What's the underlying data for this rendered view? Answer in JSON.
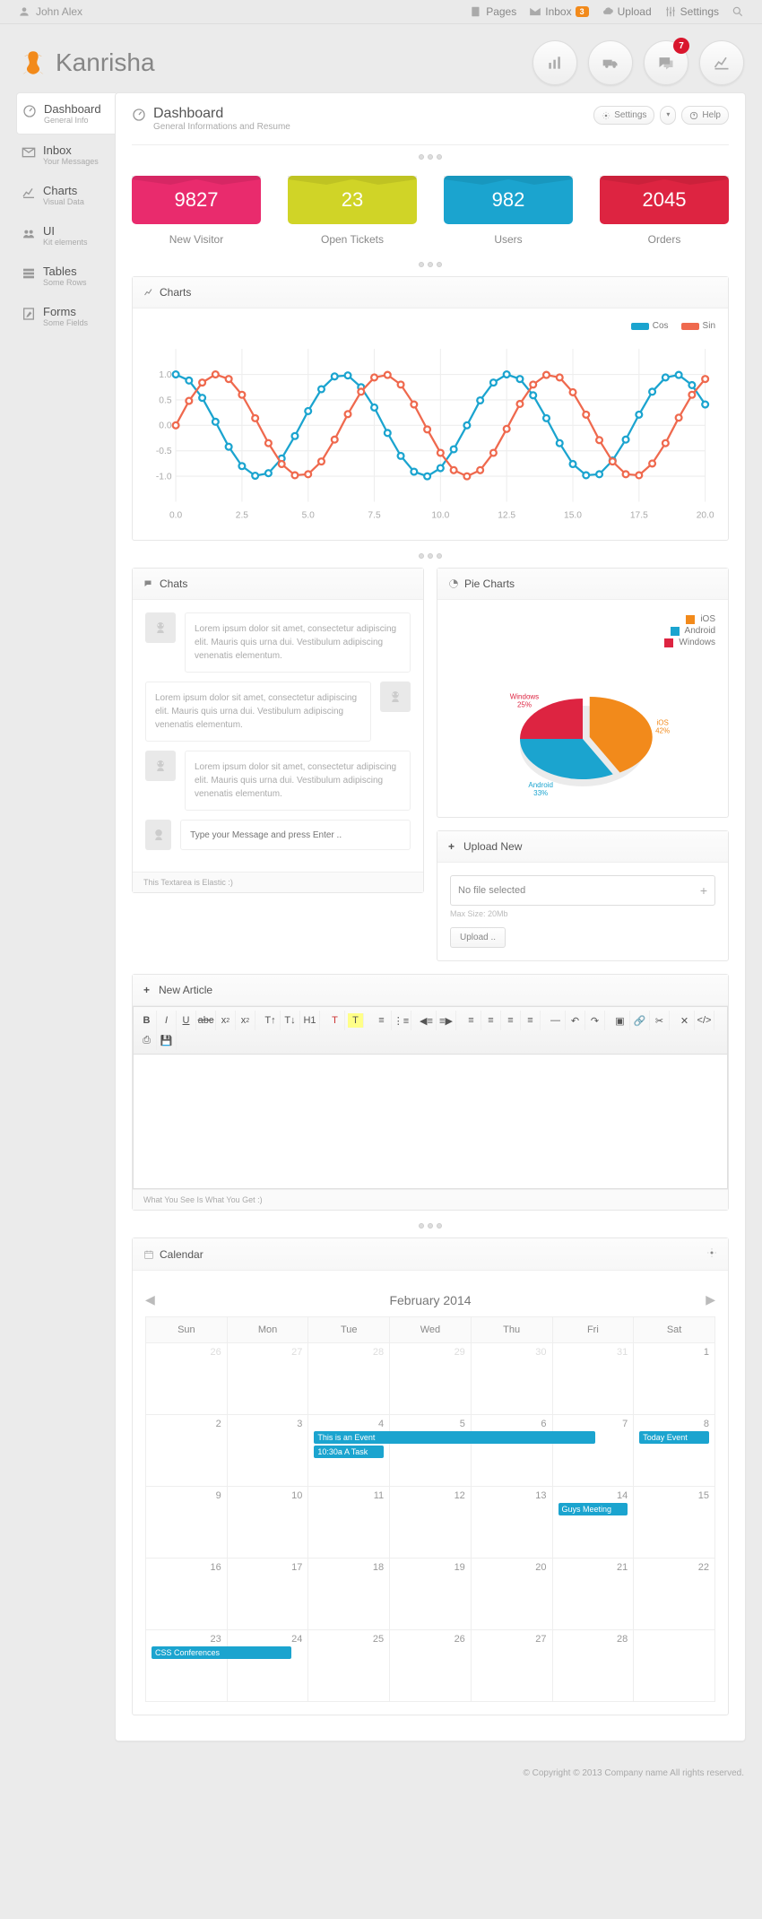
{
  "topbar": {
    "user": "John Alex",
    "items": {
      "pages": "Pages",
      "inbox": "Inbox",
      "inbox_count": "3",
      "upload": "Upload",
      "settings": "Settings"
    }
  },
  "brand": "Kanrisha",
  "header_badge": "7",
  "sidebar": {
    "items": [
      {
        "t": "Dashboard",
        "s": "General Info"
      },
      {
        "t": "Inbox",
        "s": "Your Messages"
      },
      {
        "t": "Charts",
        "s": "Visual Data"
      },
      {
        "t": "UI",
        "s": "Kit elements"
      },
      {
        "t": "Tables",
        "s": "Some Rows"
      },
      {
        "t": "Forms",
        "s": "Some Fields"
      }
    ]
  },
  "page": {
    "title": "Dashboard",
    "subtitle": "General Informations and Resume",
    "settings": "Settings",
    "help": "Help"
  },
  "stats": [
    {
      "value": "9827",
      "label": "New Visitor",
      "color": "c-pink"
    },
    {
      "value": "23",
      "label": "Open Tickets",
      "color": "c-yellow"
    },
    {
      "value": "982",
      "label": "Users",
      "color": "c-blue"
    },
    {
      "value": "2045",
      "label": "Orders",
      "color": "c-red"
    }
  ],
  "charts_panel": {
    "title": "Charts"
  },
  "chart_data": [
    {
      "type": "line",
      "title": "Charts",
      "xlabel": "",
      "ylabel": "",
      "x_range": [
        0,
        20
      ],
      "y_range": [
        -1.5,
        1.5
      ],
      "x_ticks": [
        0,
        2.5,
        5.0,
        7.5,
        10.0,
        12.5,
        15.0,
        17.5,
        20.0
      ],
      "y_ticks": [
        -1.0,
        -0.5,
        0.0,
        0.5,
        1.0
      ],
      "series": [
        {
          "name": "Cos",
          "color": "#1ba4cf",
          "x": [
            0,
            0.5,
            1,
            1.5,
            2,
            2.5,
            3,
            3.5,
            4,
            4.5,
            5,
            5.5,
            6,
            6.5,
            7,
            7.5,
            8,
            8.5,
            9,
            9.5,
            10,
            10.5,
            11,
            11.5,
            12,
            12.5,
            13,
            13.5,
            14,
            14.5,
            15,
            15.5,
            16,
            16.5,
            17,
            17.5,
            18,
            18.5,
            19,
            19.5,
            20
          ],
          "values": [
            1.0,
            0.88,
            0.54,
            0.07,
            -0.42,
            -0.8,
            -0.99,
            -0.94,
            -0.65,
            -0.21,
            0.28,
            0.71,
            0.96,
            0.98,
            0.75,
            0.35,
            -0.15,
            -0.6,
            -0.91,
            -1.0,
            -0.84,
            -0.47,
            0.0,
            0.49,
            0.84,
            1.0,
            0.91,
            0.59,
            0.14,
            -0.35,
            -0.76,
            -0.98,
            -0.96,
            -0.69,
            -0.28,
            0.21,
            0.66,
            0.94,
            0.99,
            0.79,
            0.41
          ]
        },
        {
          "name": "Sin",
          "color": "#ef694e",
          "x": [
            0,
            0.5,
            1,
            1.5,
            2,
            2.5,
            3,
            3.5,
            4,
            4.5,
            5,
            5.5,
            6,
            6.5,
            7,
            7.5,
            8,
            8.5,
            9,
            9.5,
            10,
            10.5,
            11,
            11.5,
            12,
            12.5,
            13,
            13.5,
            14,
            14.5,
            15,
            15.5,
            16,
            16.5,
            17,
            17.5,
            18,
            18.5,
            19,
            19.5,
            20
          ],
          "values": [
            0.0,
            0.48,
            0.84,
            1.0,
            0.91,
            0.6,
            0.14,
            -0.35,
            -0.76,
            -0.98,
            -0.96,
            -0.71,
            -0.28,
            0.22,
            0.66,
            0.94,
            0.99,
            0.8,
            0.41,
            -0.08,
            -0.54,
            -0.88,
            -1.0,
            -0.88,
            -0.54,
            -0.07,
            0.42,
            0.8,
            0.99,
            0.94,
            0.65,
            0.21,
            -0.29,
            -0.71,
            -0.96,
            -0.98,
            -0.75,
            -0.35,
            0.15,
            0.6,
            0.91
          ]
        }
      ]
    },
    {
      "type": "pie",
      "title": "Pie Charts",
      "series": [
        {
          "name": "iOS",
          "value": 42,
          "label": "iOS 42%",
          "color": "#f28a1b"
        },
        {
          "name": "Android",
          "value": 33,
          "label": "Android 33%",
          "color": "#1ba4cf"
        },
        {
          "name": "Windows",
          "value": 25,
          "label": "Windows 25%",
          "color": "#dd2441"
        }
      ]
    }
  ],
  "chats": {
    "title": "Chats",
    "items": [
      "Lorem ipsum dolor sit amet, consectetur adipiscing elit. Mauris quis urna dui. Vestibulum adipiscing venenatis elementum.",
      "Lorem ipsum dolor sit amet, consectetur adipiscing elit. Mauris quis urna dui. Vestibulum adipiscing venenatis elementum.",
      "Lorem ipsum dolor sit amet, consectetur adipiscing elit. Mauris quis urna dui. Vestibulum adipiscing venenatis elementum."
    ],
    "placeholder": "Type your Message and press Enter ..",
    "footer": "This Textarea is Elastic :)"
  },
  "pie_panel": {
    "title": "Pie Charts"
  },
  "upload": {
    "title": "Upload New",
    "placeholder": "No file selected",
    "hint": "Max Size: 20Mb",
    "button": "Upload .."
  },
  "article": {
    "title": "New Article",
    "footer": "What You See Is What You Get :)"
  },
  "calendar": {
    "title": "Calendar",
    "month": "February 2014",
    "days": [
      "Sun",
      "Mon",
      "Tue",
      "Wed",
      "Thu",
      "Fri",
      "Sat"
    ],
    "weeks": [
      [
        {
          "d": "26",
          "o": 1
        },
        {
          "d": "27",
          "o": 1
        },
        {
          "d": "28",
          "o": 1
        },
        {
          "d": "29",
          "o": 1
        },
        {
          "d": "30",
          "o": 1
        },
        {
          "d": "31",
          "o": 1
        },
        {
          "d": "1"
        }
      ],
      [
        {
          "d": "2"
        },
        {
          "d": "3"
        },
        {
          "d": "4",
          "events": [
            {
              "t": "This is an Event",
              "span": 4
            }
          ]
        },
        {
          "d": "5"
        },
        {
          "d": "6"
        },
        {
          "d": "7"
        },
        {
          "d": "8",
          "events": [
            {
              "t": "Today Event"
            }
          ]
        }
      ],
      [
        {
          "d": "9"
        },
        {
          "d": "10"
        },
        {
          "d": "11"
        },
        {
          "d": "12"
        },
        {
          "d": "13"
        },
        {
          "d": "14",
          "events": [
            {
              "t": "Guys Meeting"
            }
          ]
        },
        {
          "d": "15"
        }
      ],
      [
        {
          "d": "16"
        },
        {
          "d": "17"
        },
        {
          "d": "18"
        },
        {
          "d": "19"
        },
        {
          "d": "20"
        },
        {
          "d": "21"
        },
        {
          "d": "22"
        }
      ],
      [
        {
          "d": "23",
          "events": [
            {
              "t": "CSS Conferences",
              "span": 2
            }
          ]
        },
        {
          "d": "24"
        },
        {
          "d": "25"
        },
        {
          "d": "26"
        },
        {
          "d": "27"
        },
        {
          "d": "28"
        },
        {
          "d": ""
        }
      ]
    ],
    "extra_event": "10:30a A Task"
  },
  "footer": "© Copyright © 2013 Company name All rights reserved."
}
